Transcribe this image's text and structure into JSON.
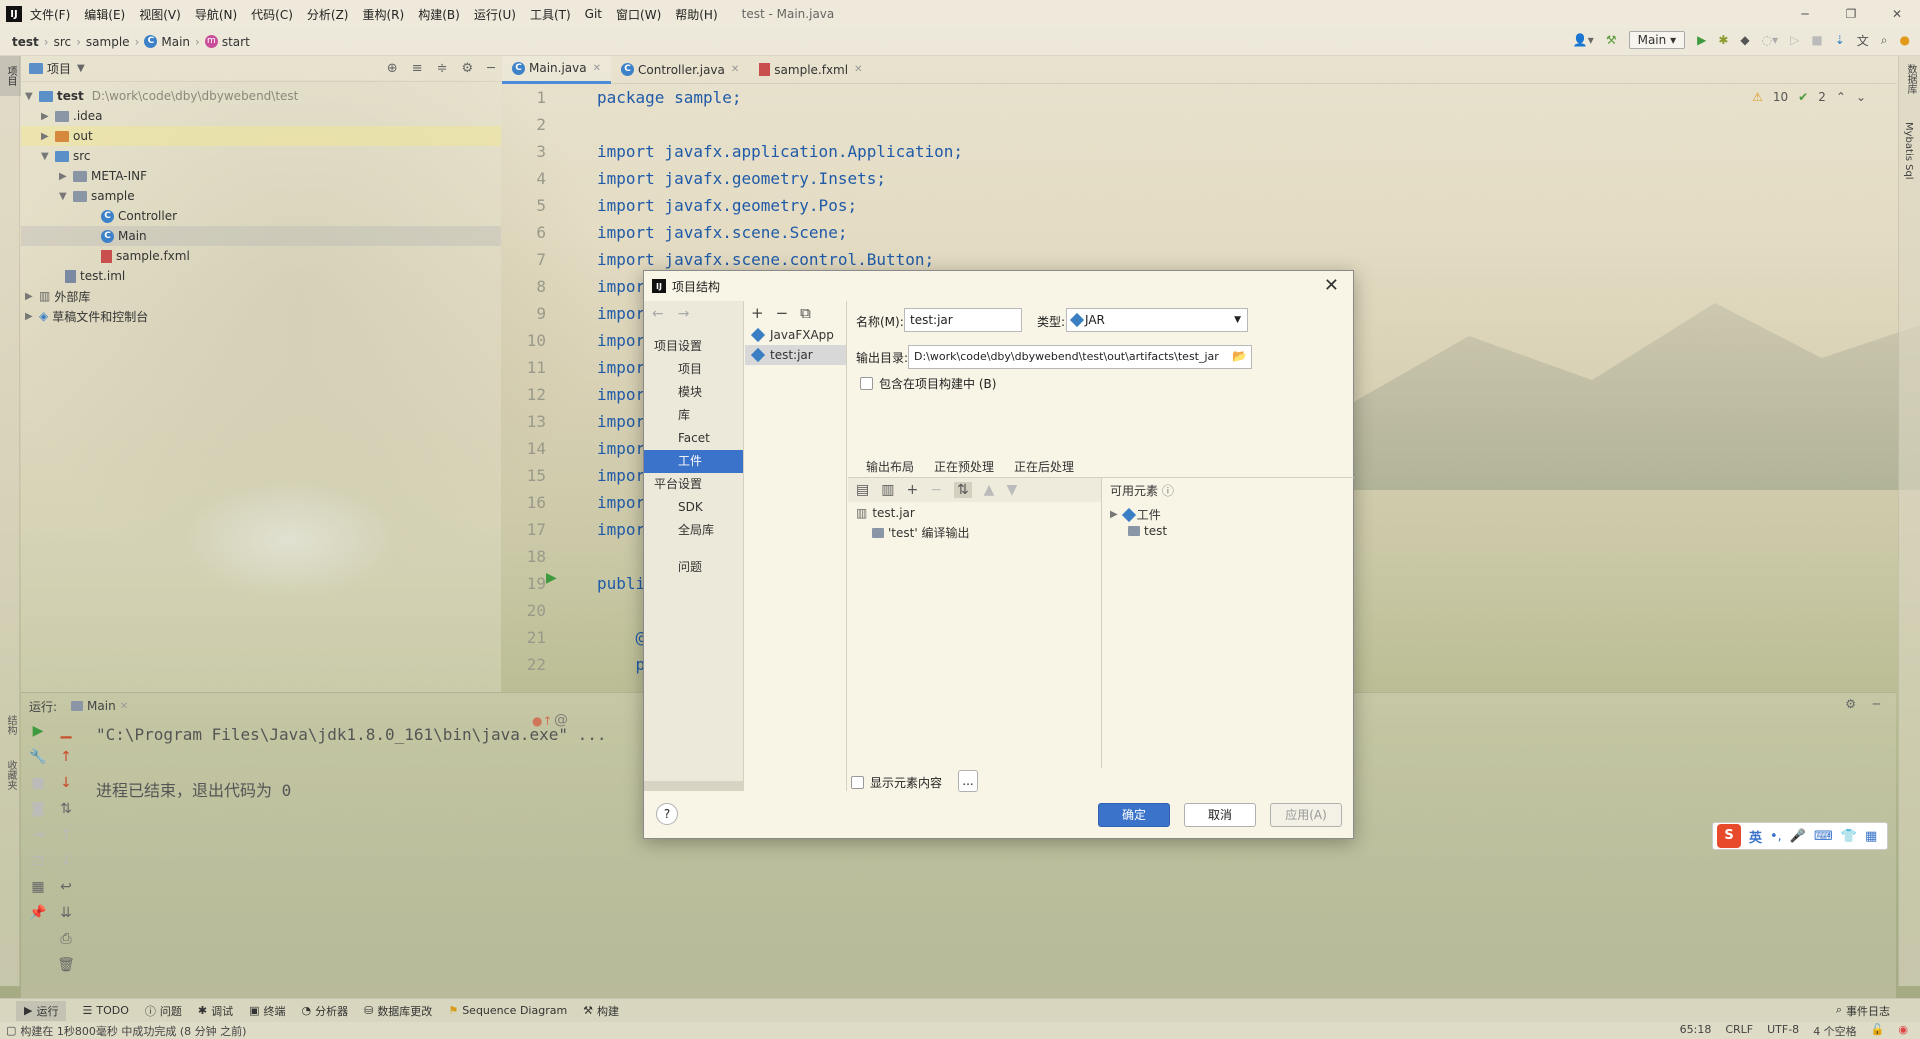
{
  "menubar": {
    "logo": "IJ",
    "items": [
      "文件(F)",
      "编辑(E)",
      "视图(V)",
      "导航(N)",
      "代码(C)",
      "分析(Z)",
      "重构(R)",
      "构建(B)",
      "运行(U)",
      "工具(T)",
      "Git",
      "窗口(W)",
      "帮助(H)"
    ],
    "window_title": "test - Main.java"
  },
  "navbar": {
    "crumbs": [
      "test",
      "src",
      "sample",
      "Main",
      "start"
    ],
    "run_config": "Main"
  },
  "project": {
    "title": "项目",
    "root_name": "test",
    "root_path": "D:\\work\\code\\dby\\dbywebend\\test",
    "items": [
      ".idea",
      "out",
      "src",
      "META-INF",
      "sample",
      "Controller",
      "Main",
      "sample.fxml",
      "test.iml",
      "外部库",
      "草稿文件和控制台"
    ]
  },
  "editor": {
    "tabs": [
      "Main.java",
      "Controller.java",
      "sample.fxml"
    ],
    "line_numbers": [
      "1",
      "2",
      "3",
      "4",
      "5",
      "6",
      "7",
      "8",
      "9",
      "10",
      "11",
      "12",
      "13",
      "14",
      "15",
      "16",
      "17",
      "18",
      "19",
      "20",
      "21",
      "22"
    ],
    "lines": [
      "package sample;",
      "",
      "import javafx.application.Application;",
      "import javafx.geometry.Insets;",
      "import javafx.geometry.Pos;",
      "import javafx.scene.Scene;",
      "import javafx.scene.control.Button;",
      "impor",
      "impor",
      "impor",
      "impor",
      "impor",
      "impor",
      "impor",
      "impor",
      "impor",
      "impor",
      "",
      "publi",
      "",
      "    @",
      "    p"
    ],
    "warnings": "10",
    "checks": "2"
  },
  "run": {
    "label": "运行:",
    "tab": "Main",
    "cmd": "\"C:\\Program Files\\Java\\jdk1.8.0_161\\bin\\java.exe\" ...",
    "exit": "进程已结束，退出代码为 0"
  },
  "toolwindows": [
    "运行",
    "TODO",
    "问题",
    "调试",
    "终端",
    "分析器",
    "数据库更改",
    "Sequence Diagram",
    "构建"
  ],
  "event_log": "事件日志",
  "status": {
    "message": "构建在 1秒800毫秒 中成功完成 (8 分钟 之前)",
    "position": "65:18",
    "line_sep": "CRLF",
    "encoding": "UTF-8",
    "indent": "4 个空格"
  },
  "right_strip": [
    "数据库",
    "Mybatis Sql"
  ],
  "left_strip": [
    "项目",
    "结构",
    "收藏夹"
  ],
  "ime": {
    "lang": "英"
  },
  "dialog": {
    "title": "项目结构",
    "nav": {
      "project_settings": "项目设置",
      "project_items": [
        "项目",
        "模块",
        "库",
        "Facet",
        "工件"
      ],
      "platform_settings": "平台设置",
      "platform_items": [
        "SDK",
        "全局库"
      ],
      "problems": "问题"
    },
    "artifacts": [
      "JavaFXApp",
      "test:jar"
    ],
    "name_label": "名称(M):",
    "name_value": "test:jar",
    "type_label": "类型:",
    "type_value": "JAR",
    "output_label": "输出目录:",
    "output_value": "D:\\work\\code\\dby\\dbywebend\\test\\out\\artifacts\\test_jar",
    "include_in_build": "包含在项目构建中 (B)",
    "tabs": [
      "输出布局",
      "正在预处理",
      "正在后处理"
    ],
    "available_label": "可用元素",
    "layout_items": [
      "test.jar",
      "'test' 编译输出"
    ],
    "available_items": [
      "工件",
      "test"
    ],
    "show_content": "显示元素内容",
    "more": "...",
    "ok": "确定",
    "cancel": "取消",
    "apply": "应用(A)",
    "help": "?"
  }
}
